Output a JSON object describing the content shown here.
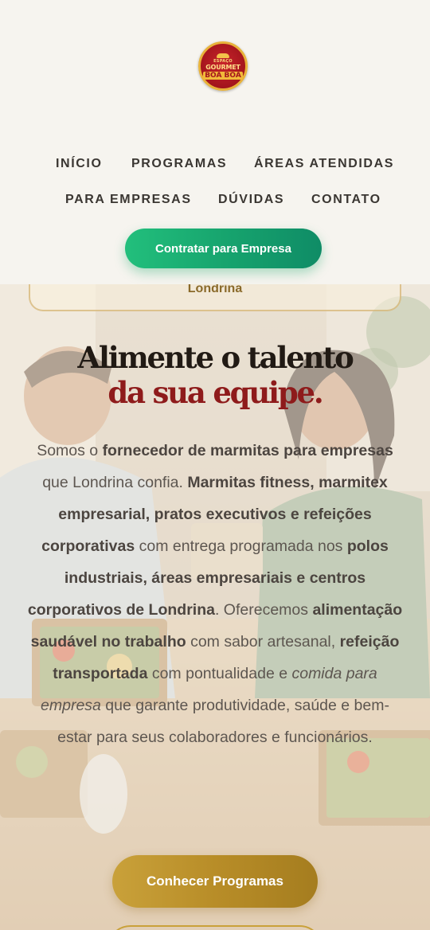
{
  "header": {
    "logo": {
      "line1": "ESPAÇO",
      "line2": "GOURMET",
      "line3": "BOA BOA"
    },
    "nav": [
      {
        "label": "INÍCIO"
      },
      {
        "label": "PROGRAMAS"
      },
      {
        "label": "ÁREAS ATENDIDAS"
      },
      {
        "label": "PARA EMPRESAS"
      },
      {
        "label": "DÚVIDAS"
      },
      {
        "label": "CONTATO"
      }
    ],
    "cta_label": "Contratar para Empresa"
  },
  "hero": {
    "badge_text": "Londrina",
    "headline_line1": "Alimente o talento",
    "headline_line2": "da sua equipe.",
    "description": [
      {
        "t": "Somos o ",
        "b": false
      },
      {
        "t": "fornecedor de marmitas para empresas",
        "b": true
      },
      {
        "t": " que Londrina confia. ",
        "b": false
      },
      {
        "t": "Marmitas fitness, marmitex empresarial, pratos executivos e refeições corporativas",
        "b": true
      },
      {
        "t": " com entrega programada nos ",
        "b": false
      },
      {
        "t": "polos industriais, áreas empresariais e centros corporativos de Londrina",
        "b": true
      },
      {
        "t": ". Oferecemos ",
        "b": false
      },
      {
        "t": "alimentação saudável no trabalho",
        "b": true
      },
      {
        "t": " com sabor artesanal, ",
        "b": false
      },
      {
        "t": "refeição transportada",
        "b": true
      },
      {
        "t": " com pontualidade e ",
        "b": false
      },
      {
        "t": "comida para empresa",
        "i": true
      },
      {
        "t": " que garante produtividade, saúde e bem-estar para seus colaboradores e funcionários.",
        "b": false
      }
    ],
    "cta_label": "Conhecer Programas"
  },
  "colors": {
    "background": "#f6f4ef",
    "nav_text": "#3a3632",
    "cta_green": "#16a26d",
    "cta_gold": "#b88d28",
    "headline_dark": "#211a14",
    "headline_red": "#8e1b1b"
  }
}
